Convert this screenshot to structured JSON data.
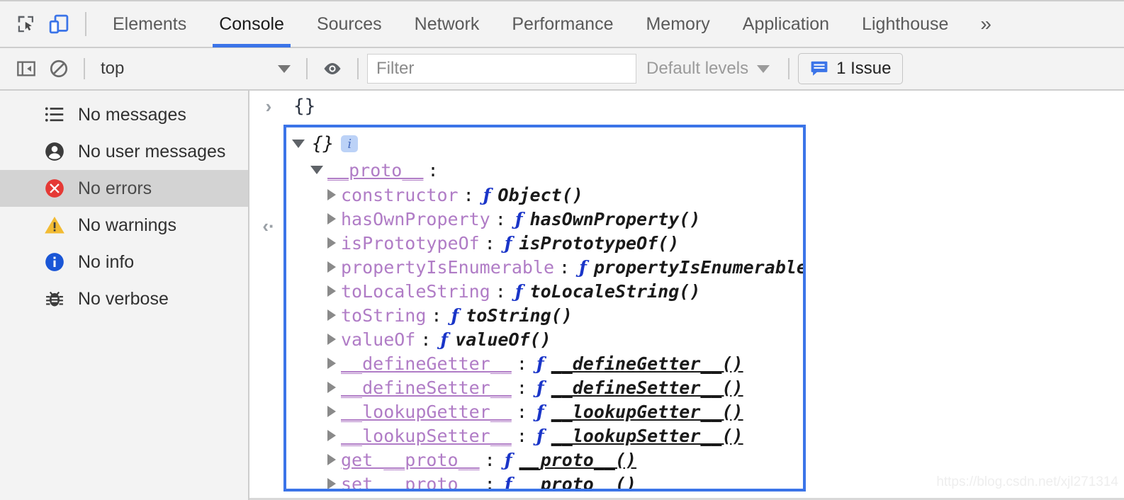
{
  "devtools": {
    "left_icons": [
      {
        "name": "inspect-element-icon",
        "title": "Inspect element"
      },
      {
        "name": "device-toolbar-icon",
        "title": "Toggle device toolbar",
        "active": true,
        "color": "#3b74e8"
      }
    ],
    "tabs": [
      {
        "label": "Elements",
        "active": false
      },
      {
        "label": "Console",
        "active": true
      },
      {
        "label": "Sources",
        "active": false
      },
      {
        "label": "Network",
        "active": false
      },
      {
        "label": "Performance",
        "active": false
      },
      {
        "label": "Memory",
        "active": false
      },
      {
        "label": "Application",
        "active": false
      },
      {
        "label": "Lighthouse",
        "active": false
      }
    ],
    "more_tabs_label": "»",
    "active_tab_color": "#3b74e8"
  },
  "toolbar": {
    "sidebar_toggle_icon": "sidebar-toggle-icon",
    "clear_console_icon": "clear-console-icon",
    "context": {
      "value": "top",
      "caret": "▼"
    },
    "eye_icon": "eye-icon",
    "filter": {
      "value": "",
      "placeholder": "Filter"
    },
    "levels": {
      "label": "Default levels",
      "caret": "▼"
    },
    "issues": {
      "icon": "issue-message-icon",
      "label": "1 Issue",
      "icon_color": "#3b74e8"
    }
  },
  "sidebar": {
    "items": [
      {
        "label": "No messages",
        "icon": "list-icon",
        "icon_color": "#3c3c3c",
        "selected": false
      },
      {
        "label": "No user messages",
        "icon": "person-icon",
        "icon_color": "#3c3c3c",
        "selected": false
      },
      {
        "label": "No errors",
        "icon": "error-icon",
        "icon_color": "#e53935",
        "selected": true
      },
      {
        "label": "No warnings",
        "icon": "warning-icon",
        "icon_color": "#f2bb33",
        "selected": false
      },
      {
        "label": "No info",
        "icon": "info-icon",
        "icon_color": "#1a56d6",
        "selected": false
      },
      {
        "label": "No verbose",
        "icon": "bug-icon",
        "icon_color": "#3c3c3c",
        "selected": false
      }
    ]
  },
  "console": {
    "input_chevron": "›",
    "input_expression": "{}",
    "result_chevron": "‹·",
    "result": {
      "preview": "{}",
      "info_badge": "i",
      "expanded": true,
      "highlight_color": "#3b74e8",
      "proto_label": "__proto__",
      "proto_colon": ":",
      "properties": [
        {
          "name": "constructor",
          "underline": false,
          "fn": "ƒ",
          "value": "Object()",
          "value_underline": false
        },
        {
          "name": "hasOwnProperty",
          "underline": false,
          "fn": "ƒ",
          "value": "hasOwnProperty()",
          "value_underline": false
        },
        {
          "name": "isPrototypeOf",
          "underline": false,
          "fn": "ƒ",
          "value": "isPrototypeOf()",
          "value_underline": false
        },
        {
          "name": "propertyIsEnumerable",
          "underline": false,
          "fn": "ƒ",
          "value": "propertyIsEnumerable()",
          "value_underline": false
        },
        {
          "name": "toLocaleString",
          "underline": false,
          "fn": "ƒ",
          "value": "toLocaleString()",
          "value_underline": false
        },
        {
          "name": "toString",
          "underline": false,
          "fn": "ƒ",
          "value": "toString()",
          "value_underline": false
        },
        {
          "name": "valueOf",
          "underline": false,
          "fn": "ƒ",
          "value": "valueOf()",
          "value_underline": false
        },
        {
          "name": "__defineGetter__",
          "underline": true,
          "fn": "ƒ",
          "value": "__defineGetter__()",
          "value_underline": true
        },
        {
          "name": "__defineSetter__",
          "underline": true,
          "fn": "ƒ",
          "value": "__defineSetter__()",
          "value_underline": true
        },
        {
          "name": "__lookupGetter__",
          "underline": true,
          "fn": "ƒ",
          "value": "__lookupGetter__()",
          "value_underline": true
        },
        {
          "name": "__lookupSetter__",
          "underline": true,
          "fn": "ƒ",
          "value": "__lookupSetter__()",
          "value_underline": true
        },
        {
          "name": "get __proto__",
          "underline": true,
          "fn": "ƒ",
          "value": "__proto__()",
          "value_underline": true
        },
        {
          "name": "set __proto__",
          "underline": true,
          "fn": "ƒ",
          "value": "__proto__()",
          "value_underline": true
        }
      ]
    }
  },
  "watermark": {
    "text": "https://blog.csdn.net/xjl271314"
  }
}
